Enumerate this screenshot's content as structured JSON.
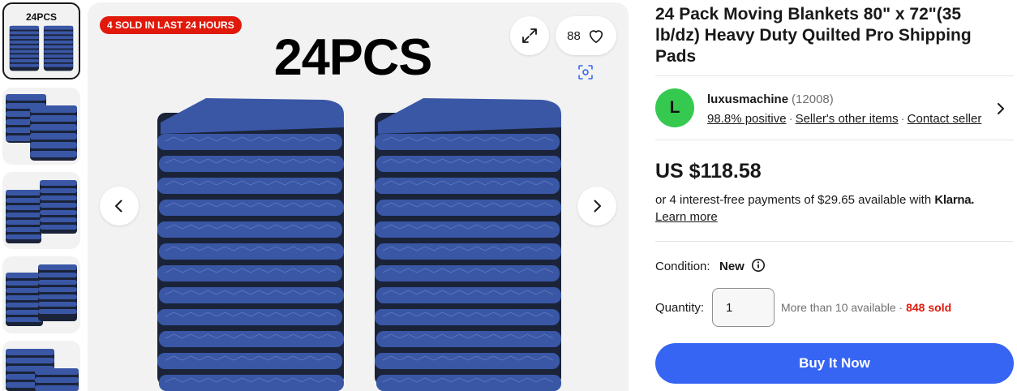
{
  "gallery": {
    "thumbnails": [
      {
        "caption": "24PCS",
        "name": "thumbnail-1"
      },
      {
        "caption": "",
        "name": "thumbnail-2"
      },
      {
        "caption": "",
        "name": "thumbnail-3"
      },
      {
        "caption": "",
        "name": "thumbnail-4"
      },
      {
        "caption": "",
        "name": "thumbnail-5"
      }
    ],
    "selected_index": 0
  },
  "hero": {
    "caption": "24PCS",
    "sold_badge": "4 SOLD IN LAST 24 HOURS",
    "watch_count": "88",
    "blanket_color": "#3a57a6",
    "blanket_dark": "#1a2338"
  },
  "listing": {
    "title": "24 Pack Moving Blankets 80\" x 72\"(35 lb/dz) Heavy Duty Quilted Pro Shipping Pads",
    "seller": {
      "avatar_letter": "L",
      "avatar_color": "#36c94f",
      "name": "luxusmachine",
      "feedback_count": "(12008)",
      "positive": "98.8% positive",
      "other_items": "Seller's other items",
      "contact": "Contact seller"
    },
    "price": "US $118.58",
    "installments_text": "or 4 interest-free payments of $29.65 available with",
    "klarna_brand": "Klarna.",
    "learn_more": "Learn more",
    "condition_label": "Condition:",
    "condition_value": "New",
    "quantity_label": "Quantity:",
    "quantity_value": "1",
    "availability": "More than 10 available",
    "sold_count": "848 sold",
    "buy_now": "Buy It Now"
  },
  "colors": {
    "accent_blue": "#3665f3",
    "badge_red": "#e0190b"
  }
}
